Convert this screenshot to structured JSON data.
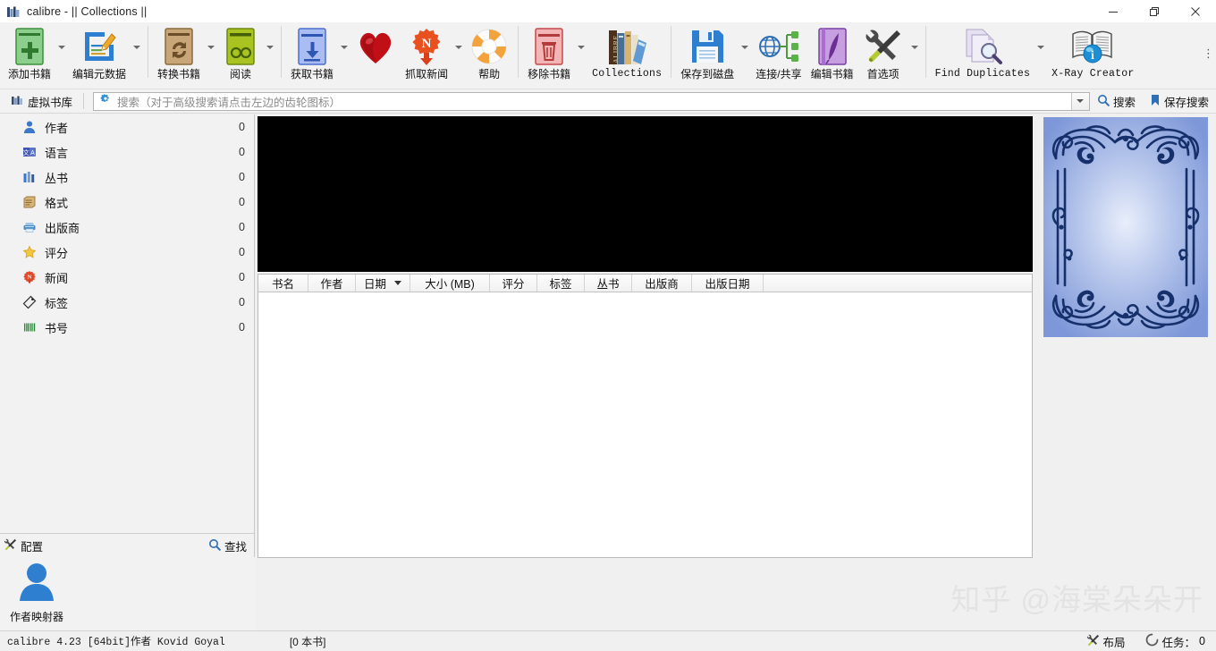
{
  "window": {
    "title": "calibre - || Collections ||",
    "app_icon": "calibre-books-icon",
    "minimize": "—",
    "maximize": "❐",
    "close": "✕"
  },
  "toolbar": {
    "overflow_label": "⋮",
    "items": [
      {
        "label": "添加书籍",
        "icon": "add-book-icon",
        "has_arrow": true,
        "mono": false
      },
      {
        "label": "编辑元数据",
        "icon": "edit-metadata-icon",
        "has_arrow": true,
        "mono": false
      },
      {
        "label": "转换书籍",
        "icon": "convert-book-icon",
        "has_arrow": true,
        "mono": false
      },
      {
        "label": "阅读",
        "icon": "read-book-icon",
        "has_arrow": true,
        "mono": false
      },
      {
        "label": "获取书籍",
        "icon": "get-books-icon",
        "has_arrow": true,
        "mono": false
      },
      {
        "label": "",
        "icon": "heart-icon",
        "has_arrow": false,
        "mono": false
      },
      {
        "label": "抓取新闻",
        "icon": "fetch-news-icon",
        "has_arrow": true,
        "mono": false
      },
      {
        "label": "帮助",
        "icon": "help-icon",
        "has_arrow": false,
        "mono": false
      },
      {
        "label": "移除书籍",
        "icon": "remove-books-icon",
        "has_arrow": true,
        "mono": false
      },
      {
        "label": "Collections",
        "icon": "collections-icon",
        "has_arrow": false,
        "mono": true
      },
      {
        "label": "保存到磁盘",
        "icon": "save-to-disk-icon",
        "has_arrow": true,
        "mono": false
      },
      {
        "label": "连接/共享",
        "icon": "connect-share-icon",
        "has_arrow": false,
        "mono": false
      },
      {
        "label": "编辑书籍",
        "icon": "edit-book-icon",
        "has_arrow": false,
        "mono": false
      },
      {
        "label": "首选项",
        "icon": "preferences-icon",
        "has_arrow": true,
        "mono": false
      },
      {
        "label": "Find Duplicates",
        "icon": "find-duplicates-icon",
        "has_arrow": true,
        "mono": true
      },
      {
        "label": "X-Ray Creator",
        "icon": "xray-creator-icon",
        "has_arrow": false,
        "mono": true
      }
    ]
  },
  "searchrow": {
    "virtual_library_label": "虚拟书库",
    "virtual_library_icon": "library-icon",
    "search_gear_icon": "gear-icon",
    "search_placeholder": "搜索（对于高级搜索请点击左边的齿轮图标）",
    "search_value": "",
    "dropdown_icon": "chevron-down-icon",
    "search_button_label": "搜索",
    "search_button_icon": "magnifier-icon",
    "save_search_label": "保存搜索",
    "save_search_icon": "bookmark-icon"
  },
  "sidebar": {
    "items": [
      {
        "label": "作者",
        "count": "0",
        "icon": "author-icon"
      },
      {
        "label": "语言",
        "count": "0",
        "icon": "language-icon"
      },
      {
        "label": "丛书",
        "count": "0",
        "icon": "series-icon"
      },
      {
        "label": "格式",
        "count": "0",
        "icon": "format-icon"
      },
      {
        "label": "出版商",
        "count": "0",
        "icon": "publisher-icon"
      },
      {
        "label": "评分",
        "count": "0",
        "icon": "rating-icon"
      },
      {
        "label": "新闻",
        "count": "0",
        "icon": "news-icon"
      },
      {
        "label": "标签",
        "count": "0",
        "icon": "tags-icon"
      },
      {
        "label": "书号",
        "count": "0",
        "icon": "identifiers-icon"
      }
    ],
    "footer": {
      "configure_label": "配置",
      "configure_icon": "tools-icon",
      "find_label": "查找",
      "find_icon": "magnifier-icon"
    }
  },
  "book_list": {
    "columns": [
      {
        "label": "书名",
        "width": 56,
        "sorted": false
      },
      {
        "label": "作者",
        "width": 53,
        "sorted": false
      },
      {
        "label": "日期",
        "width": 61,
        "sorted": true
      },
      {
        "label": "大小 (MB)",
        "width": 89,
        "sorted": false
      },
      {
        "label": "评分",
        "width": 53,
        "sorted": false
      },
      {
        "label": "标签",
        "width": 53,
        "sorted": false
      },
      {
        "label": "丛书",
        "width": 53,
        "sorted": false
      },
      {
        "label": "出版商",
        "width": 67,
        "sorted": false
      },
      {
        "label": "出版日期",
        "width": 80,
        "sorted": false
      }
    ],
    "rows": []
  },
  "author_mapper": {
    "label": "作者映射器",
    "icon": "author-mapper-icon"
  },
  "statusbar": {
    "version": "calibre 4.23 [64bit]作者 Kovid Goyal",
    "book_count": "[0 本书]",
    "layout_label": "布局",
    "layout_icon": "tools-icon",
    "jobs_label": "任务：",
    "jobs_count": "0",
    "jobs_icon": "spinner-icon"
  },
  "watermark": "知乎 @海棠朵朵开",
  "colors": {
    "toolbar_bg": "#f2f2f2",
    "panel_bg": "#f2f2f2",
    "cover_placeholder": "#000000",
    "cover_blue": "#8ea4dd",
    "accent_blue": "#2f6fc4"
  }
}
